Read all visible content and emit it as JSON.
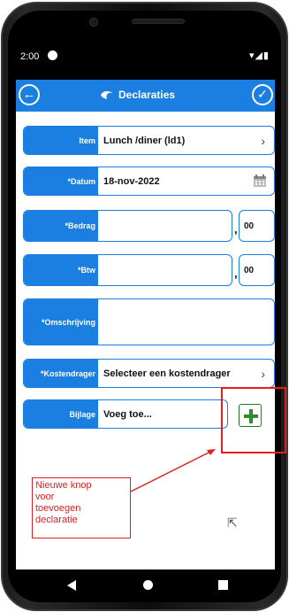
{
  "status": {
    "time": "2:00",
    "right_icons": "▾◢▮"
  },
  "appbar": {
    "title": "Declaraties",
    "back_icon": "circle-arrow-left-icon",
    "confirm_icon": "circle-check-icon",
    "logo_icon": "logo-icon"
  },
  "form": {
    "item": {
      "label": "Item",
      "value": "Lunch /diner (ld1)"
    },
    "datum": {
      "label": "*Datum",
      "value": "18-nov-2022"
    },
    "bedrag": {
      "label": "*Bedrag",
      "value": "",
      "decimals": "00"
    },
    "btw": {
      "label": "*Btw",
      "value": "",
      "decimals": "00"
    },
    "omschrijving": {
      "label": "*Omschrijving",
      "value": ""
    },
    "kostendrager": {
      "label": "*Kostendrager",
      "value": "Selecteer een kostendrager"
    },
    "bijlage": {
      "label": "Bijlage",
      "value": "Voeg toe..."
    },
    "comma": ","
  },
  "annotation": {
    "text_lines": [
      "Nieuwe knop",
      "voor",
      "toevoegen",
      "declaratie"
    ],
    "color": "#e02020"
  },
  "colors": {
    "accent": "#1a7fe0",
    "add_button": "#2e8b2e",
    "annotation": "#e02020"
  }
}
